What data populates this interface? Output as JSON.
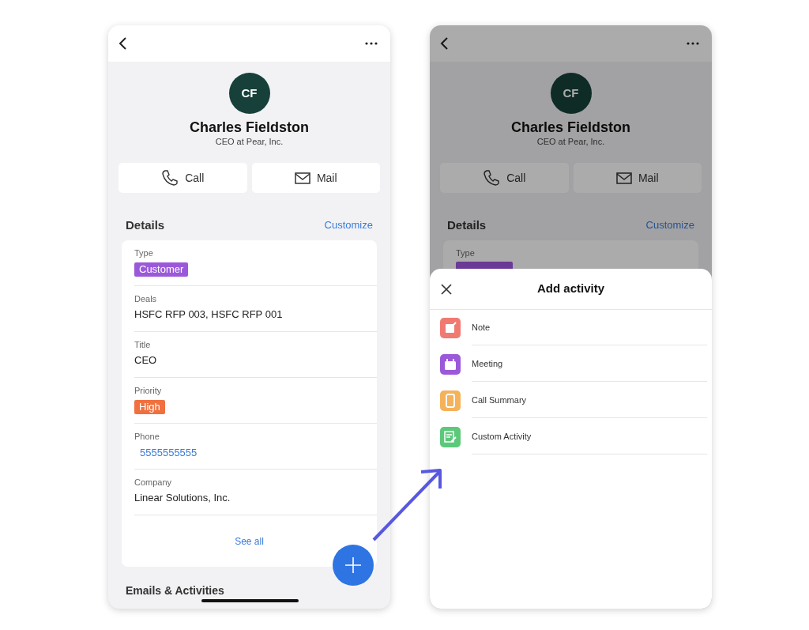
{
  "contact_screen": {
    "avatar_initials": "CF",
    "name": "Charles Fieldston",
    "subtitle": "CEO at Pear, Inc.",
    "actions": [
      {
        "label": "Call",
        "kind": "call"
      },
      {
        "label": "Mail",
        "kind": "mail"
      }
    ],
    "details": {
      "title": "Details",
      "customize": "Customize",
      "fields": [
        {
          "label": "Type",
          "value": "Customer",
          "kind": "tag",
          "color": "#9b59d9"
        },
        {
          "label": "Deals",
          "value": "HSFC RFP 003, HSFC RFP 001",
          "kind": "text"
        },
        {
          "label": "Title",
          "value": "CEO",
          "kind": "text"
        },
        {
          "label": "Priority",
          "value": "High",
          "kind": "tag",
          "color": "#f0703f"
        },
        {
          "label": "Phone",
          "value": "5555555555",
          "kind": "link"
        },
        {
          "label": "Company",
          "value": "Linear Solutions, Inc.",
          "kind": "text"
        }
      ],
      "see_all": "See all"
    },
    "section_heading": "Emails & Activities"
  },
  "dimmed_screen": {
    "avatar_initials": "CF",
    "name": "Charles Fieldston",
    "subtitle": "CEO at Pear, Inc.",
    "actions": [
      {
        "label": "Call",
        "kind": "call"
      },
      {
        "label": "Mail",
        "kind": "mail"
      }
    ],
    "details": {
      "title": "Details",
      "customize": "Customize",
      "fields": [
        {
          "label": "Type",
          "kind": "tag",
          "color": "#6a3a96"
        }
      ]
    }
  },
  "add_activity_sheet": {
    "title": "Add activity",
    "items": [
      {
        "label": "Note",
        "kind": "note",
        "color": "#f07a72"
      },
      {
        "label": "Meeting",
        "kind": "meeting",
        "color": "#9b59d9"
      },
      {
        "label": "Call Summary",
        "kind": "call",
        "color": "#f4b25a"
      },
      {
        "label": "Custom Activity",
        "kind": "custom",
        "color": "#5cc87a"
      }
    ]
  }
}
